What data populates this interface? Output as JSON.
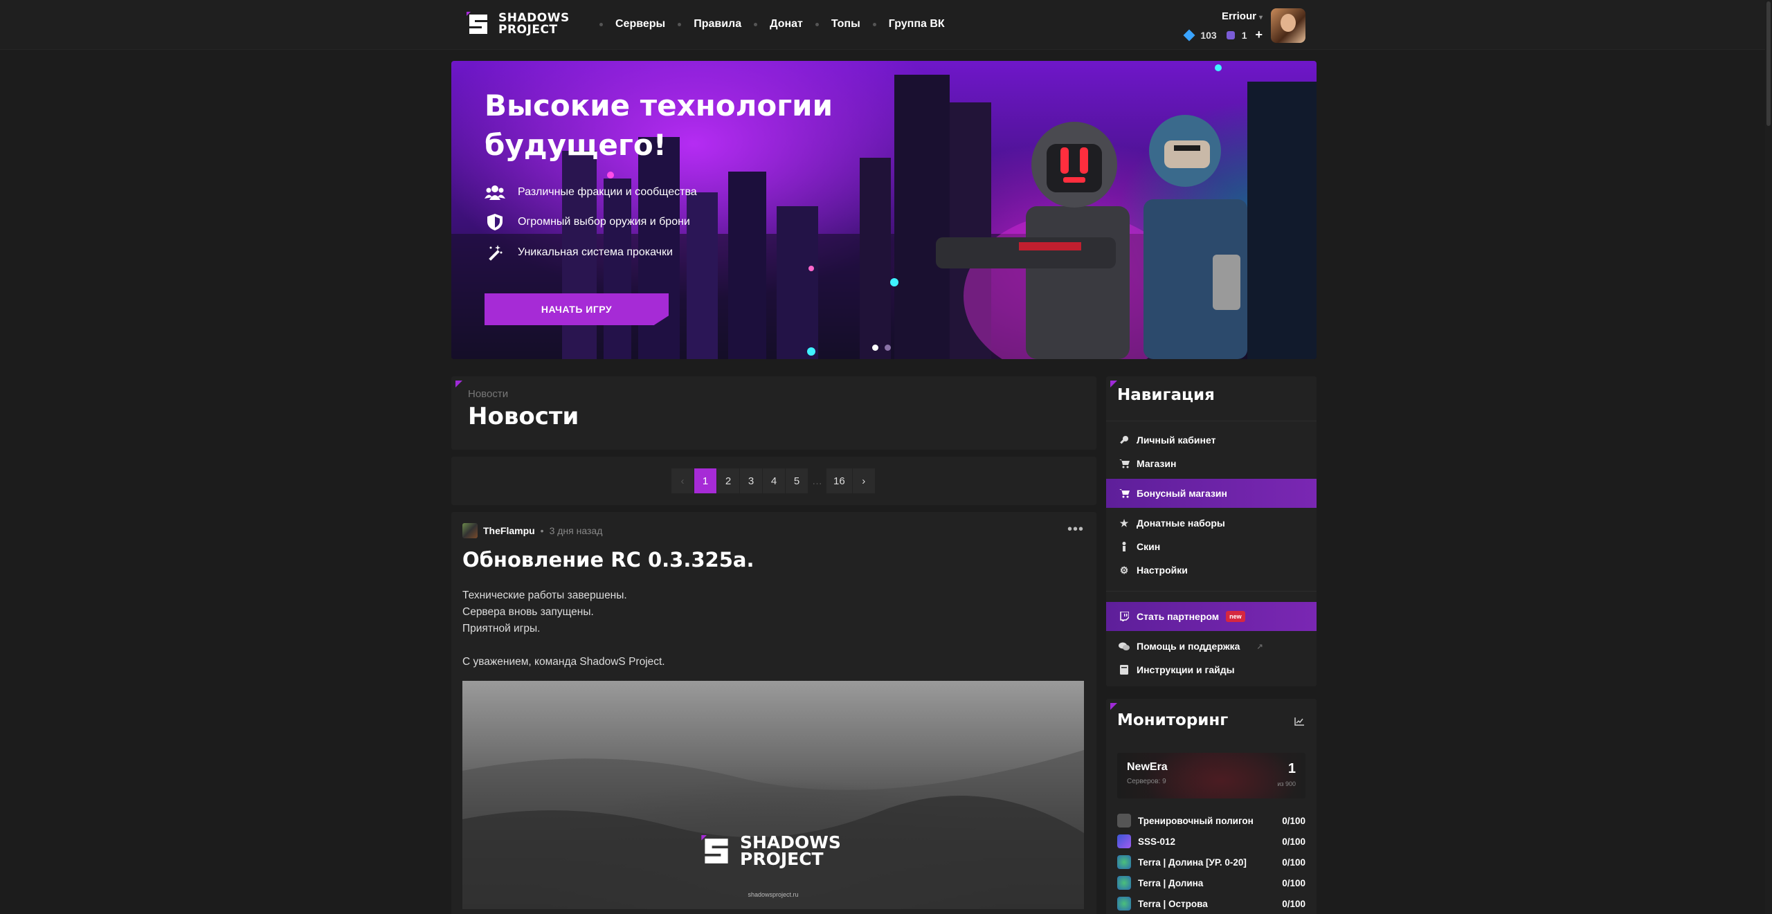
{
  "header": {
    "logo_line1": "SHADOWS",
    "logo_line2": "PROJECT",
    "nav": [
      "Серверы",
      "Правила",
      "Донат",
      "Топы",
      "Группа ВК"
    ],
    "username": "Erriour",
    "balance_gems": "103",
    "balance_coins": "1",
    "add_label": "+"
  },
  "hero": {
    "title_line1": "Высокие технологии",
    "title_line2": "будущего!",
    "features": [
      {
        "icon": "users-icon",
        "text": "Различные фракции и сообщества"
      },
      {
        "icon": "shield-icon",
        "text": "Огромный выбор оружия и брони"
      },
      {
        "icon": "magic-wand-icon",
        "text": "Уникальная система прокачки"
      }
    ],
    "cta_label": "НАЧАТЬ ИГРУ",
    "slide_count": 2,
    "active_slide": 1
  },
  "news_header": {
    "breadcrumb": "Новости",
    "title": "Новости"
  },
  "pagination": {
    "prev": "‹",
    "pages": [
      "1",
      "2",
      "3",
      "4",
      "5"
    ],
    "ellipsis": "…",
    "last": "16",
    "next": "›",
    "current": "1"
  },
  "post": {
    "author": "TheFlampu",
    "time": "3 дня назад",
    "menu": "•••",
    "title": "Обновление RC 0.3.325a.",
    "lines": [
      "Технические работы завершены.",
      "Сервера вновь запущены.",
      "Приятной игры.",
      "",
      "С уважением, команда ShadowS Project."
    ],
    "image_logo_line1": "SHADOWS",
    "image_logo_line2": "PROJECT",
    "image_url": "shadowsproject.ru"
  },
  "sidebar_nav": {
    "title": "Навигация",
    "items": [
      {
        "icon": "key-icon",
        "label": "Личный кабинет"
      },
      {
        "icon": "cart-icon",
        "label": "Магазин"
      },
      {
        "icon": "cart-icon",
        "label": "Бонусный магазин",
        "highlight": true
      },
      {
        "icon": "star-icon",
        "label": "Донатные наборы"
      },
      {
        "icon": "person-icon",
        "label": "Скин"
      },
      {
        "icon": "gear-icon",
        "label": "Настройки"
      }
    ],
    "partner_label": "Стать партнером",
    "partner_badge": "new",
    "help_label": "Помощь и поддержка",
    "guides_label": "Инструкции и гайды"
  },
  "monitoring": {
    "title": "Мониторинг",
    "card_name": "NewEra",
    "card_sub": "Серверов: 9",
    "card_num": "1",
    "card_of": "из 900",
    "servers": [
      {
        "name": "Тренировочный полигон",
        "count": "0/100",
        "color": "#555555"
      },
      {
        "name": "SSS-012",
        "count": "0/100",
        "color": "#5a4fcf"
      },
      {
        "name": "Terra | Долина [УР. 0-20]",
        "count": "0/100",
        "color": "#3b9a6a"
      },
      {
        "name": "Terra | Долина",
        "count": "0/100",
        "color": "#3b9a6a"
      },
      {
        "name": "Terra | Острова",
        "count": "0/100",
        "color": "#3b9a6a"
      }
    ]
  },
  "colors": {
    "accent": "#a62bd6",
    "background": "#1c1c1c",
    "panel": "#222222"
  }
}
